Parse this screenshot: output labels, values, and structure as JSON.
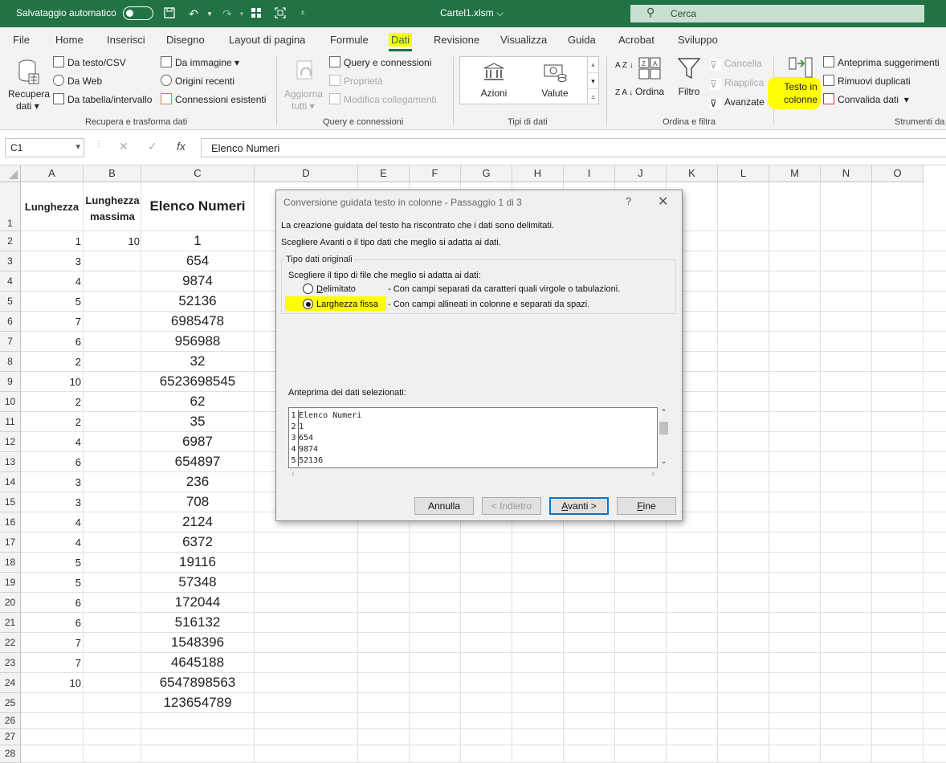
{
  "titlebar": {
    "autosave_label": "Salvataggio automatico",
    "filename": "Cartel1.xlsm",
    "filename_chevron": "⌵",
    "search_placeholder": "Cerca",
    "qat_icons": [
      "save-icon",
      "undo-icon",
      "redo-icon",
      "form-icon",
      "screenshot-icon",
      "customize-icon"
    ]
  },
  "tabs": [
    "File",
    "Home",
    "Inserisci",
    "Disegno",
    "Layout di pagina",
    "Formule",
    "Dati",
    "Revisione",
    "Visualizza",
    "Guida",
    "Acrobat",
    "Sviluppo"
  ],
  "active_tab": "Dati",
  "ribbon": {
    "get_data": {
      "recupera_line1": "Recupera",
      "recupera_line2": "dati",
      "testo_csv": "Da testo/CSV",
      "web": "Da Web",
      "tabella": "Da tabella/intervallo",
      "immagine": "Da immagine",
      "origini_recenti": "Origini recenti",
      "connessioni_esistenti": "Connessioni esistenti",
      "group_label": "Recupera e trasforma dati"
    },
    "queries": {
      "aggiorna_line1": "Aggiorna",
      "aggiorna_line2": "tutti",
      "query_connessioni": "Query e connessioni",
      "proprieta": "Proprietà",
      "modifica_collegamenti": "Modifica collegamenti",
      "group_label": "Query e connessioni"
    },
    "data_types": {
      "azioni": "Azioni",
      "valute": "Valute",
      "group_label": "Tipi di dati"
    },
    "sort_filter": {
      "ordina": "Ordina",
      "filtro": "Filtro",
      "cancella": "Cancella",
      "riapplica": "Riapplica",
      "avanzate": "Avanzate",
      "group_label": "Ordina e filtra",
      "az_label": "A Z",
      "za_label": "Z A"
    },
    "data_tools": {
      "testo_line1": "Testo in",
      "testo_line2": "colonne",
      "anteprima": "Anteprima suggerimenti",
      "rimuovi": "Rimuovi duplicati",
      "convalida": "Convalida dati",
      "group_label": "Strumenti da"
    }
  },
  "formula_bar": {
    "name_box": "C1",
    "cancel_symbol": "✕",
    "enter_symbol": "✓",
    "fx_symbol": "fx",
    "formula": "Elenco Numeri"
  },
  "sheet": {
    "columns": [
      "A",
      "B",
      "C",
      "D",
      "E",
      "F",
      "G",
      "H",
      "I",
      "J",
      "K",
      "L",
      "M",
      "N",
      "O"
    ],
    "rows": [
      "1",
      "2",
      "3",
      "4",
      "5",
      "6",
      "7",
      "8",
      "9",
      "10",
      "11",
      "12",
      "13",
      "14",
      "15",
      "16",
      "17",
      "18",
      "19",
      "20",
      "21",
      "22",
      "23",
      "24",
      "25",
      "26",
      "27",
      "28"
    ],
    "header": {
      "a1": "Lunghezza",
      "b1_line1": "Lunghezza",
      "b1_line2": "massima",
      "c1": "Elenco Numeri"
    },
    "b2": "10",
    "col_a": [
      "1",
      "3",
      "4",
      "5",
      "7",
      "6",
      "2",
      "10",
      "2",
      "2",
      "4",
      "6",
      "3",
      "3",
      "4",
      "4",
      "5",
      "5",
      "6",
      "6",
      "7",
      "7",
      "10"
    ],
    "col_c": [
      "1",
      "654",
      "9874",
      "52136",
      "6985478",
      "956988",
      "32",
      "6523698545",
      "62",
      "35",
      "6987",
      "654897",
      "236",
      "708",
      "2124",
      "6372",
      "19116",
      "57348",
      "172044",
      "516132",
      "1548396",
      "4645188",
      "6547898563",
      "123654789"
    ]
  },
  "dialog": {
    "title": "Conversione guidata testo in colonne - Passaggio 1 di 3",
    "help": "?",
    "close": "✕",
    "line1": "La creazione guidata del testo ha riscontrato che i dati sono delimitati.",
    "line2": "Scegliere Avanti o il tipo dati che meglio si adatta ai dati.",
    "group_label": "Tipo dati originali",
    "prompt": "Scegliere il tipo di file che meglio si adatta ai dati:",
    "opt1_label": "Delimitato",
    "opt1_desc": "- Con campi separati da caratteri quali virgole o tabulazioni.",
    "opt2_label": "Larghezza fissa",
    "opt2_desc": "- Con campi allineati in colonne e separati da spazi.",
    "selected_option": "Larghezza fissa",
    "preview_label": "Anteprima dei dati selezionati:",
    "preview_rows": [
      {
        "n": "1",
        "text": "Elenco Numeri"
      },
      {
        "n": "2",
        "text": "1"
      },
      {
        "n": "3",
        "text": "654"
      },
      {
        "n": "4",
        "text": "9874"
      },
      {
        "n": "5",
        "text": "52136"
      }
    ],
    "buttons": {
      "annulla": "Annulla",
      "indietro": "< Indietro",
      "avanti": "Avanti >",
      "fine": "Fine"
    }
  }
}
